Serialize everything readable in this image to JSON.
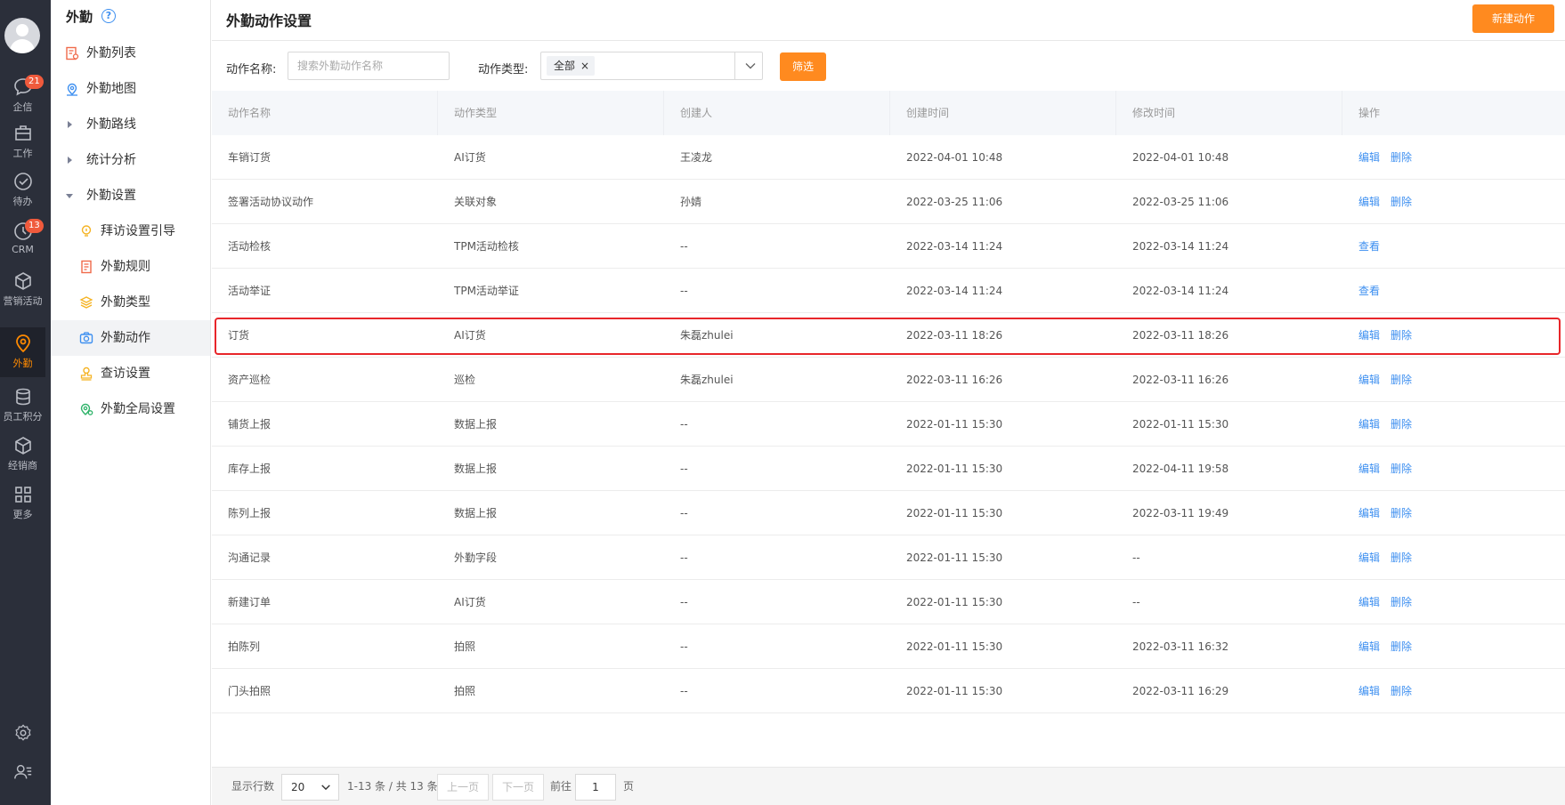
{
  "rail": {
    "items": [
      {
        "label": "企信",
        "badge": "21"
      },
      {
        "label": "工作"
      },
      {
        "label": "待办"
      },
      {
        "label": "CRM",
        "badge": "13"
      },
      {
        "label": "营销活动"
      },
      {
        "label": "外勤"
      },
      {
        "label": "员工积分"
      },
      {
        "label": "经销商"
      },
      {
        "label": "更多"
      }
    ]
  },
  "menu": {
    "title": "外勤",
    "items": [
      {
        "label": "外勤列表"
      },
      {
        "label": "外勤地图"
      },
      {
        "label": "外勤路线"
      },
      {
        "label": "统计分析"
      },
      {
        "label": "外勤设置"
      },
      {
        "label": "拜访设置引导"
      },
      {
        "label": "外勤规则"
      },
      {
        "label": "外勤类型"
      },
      {
        "label": "外勤动作"
      },
      {
        "label": "查访设置"
      },
      {
        "label": "外勤全局设置"
      }
    ]
  },
  "main": {
    "title": "外勤动作设置",
    "new_button": "新建动作",
    "filter": {
      "name_label": "动作名称:",
      "name_placeholder": "搜索外勤动作名称",
      "type_label": "动作类型:",
      "type_tag": "全部",
      "tag_close": "×",
      "filter_button": "筛选"
    }
  },
  "table": {
    "headers": [
      "动作名称",
      "动作类型",
      "创建人",
      "创建时间",
      "修改时间",
      "操作"
    ],
    "rows": [
      {
        "name": "车销订货",
        "type": "AI订货",
        "creator": "王凌龙",
        "created": "2022-04-01 10:48",
        "modified": "2022-04-01 10:48",
        "op1": "编辑",
        "op2": "删除"
      },
      {
        "name": "签署活动协议动作",
        "type": "关联对象",
        "creator": "孙婧",
        "created": "2022-03-25 11:06",
        "modified": "2022-03-25 11:06",
        "op1": "编辑",
        "op2": "删除"
      },
      {
        "name": "活动检核",
        "type": "TPM活动检核",
        "creator": "--",
        "created": "2022-03-14 11:24",
        "modified": "2022-03-14 11:24",
        "op1": "查看",
        "op2": ""
      },
      {
        "name": "活动举证",
        "type": "TPM活动举证",
        "creator": "--",
        "created": "2022-03-14 11:24",
        "modified": "2022-03-14 11:24",
        "op1": "查看",
        "op2": ""
      },
      {
        "name": "订货",
        "type": "AI订货",
        "creator": "朱磊zhulei",
        "created": "2022-03-11 18:26",
        "modified": "2022-03-11 18:26",
        "op1": "编辑",
        "op2": "删除"
      },
      {
        "name": "资产巡检",
        "type": "巡检",
        "creator": "朱磊zhulei",
        "created": "2022-03-11 16:26",
        "modified": "2022-03-11 16:26",
        "op1": "编辑",
        "op2": "删除"
      },
      {
        "name": "铺货上报",
        "type": "数据上报",
        "creator": "--",
        "created": "2022-01-11 15:30",
        "modified": "2022-01-11 15:30",
        "op1": "编辑",
        "op2": "删除"
      },
      {
        "name": "库存上报",
        "type": "数据上报",
        "creator": "--",
        "created": "2022-01-11 15:30",
        "modified": "2022-04-11 19:58",
        "op1": "编辑",
        "op2": "删除"
      },
      {
        "name": "陈列上报",
        "type": "数据上报",
        "creator": "--",
        "created": "2022-01-11 15:30",
        "modified": "2022-03-11 19:49",
        "op1": "编辑",
        "op2": "删除"
      },
      {
        "name": "沟通记录",
        "type": "外勤字段",
        "creator": "--",
        "created": "2022-01-11 15:30",
        "modified": "--",
        "op1": "编辑",
        "op2": "删除"
      },
      {
        "name": "新建订单",
        "type": "AI订货",
        "creator": "--",
        "created": "2022-01-11 15:30",
        "modified": "--",
        "op1": "编辑",
        "op2": "删除"
      },
      {
        "name": "拍陈列",
        "type": "拍照",
        "creator": "--",
        "created": "2022-01-11 15:30",
        "modified": "2022-03-11 16:32",
        "op1": "编辑",
        "op2": "删除"
      },
      {
        "name": "门头拍照",
        "type": "拍照",
        "creator": "--",
        "created": "2022-01-11 15:30",
        "modified": "2022-03-11 16:29",
        "op1": "编辑",
        "op2": "删除"
      }
    ]
  },
  "pagination": {
    "rows_label": "显示行数",
    "page_size": "20",
    "summary": "1-13 条 / 共 13 条",
    "prev": "上一页",
    "next": "下一页",
    "goto_label": "前往",
    "current_page": "1",
    "page_unit": "页"
  },
  "colors": {
    "accent": "#ff8a1f",
    "link": "#3d8ff0",
    "highlight": "#e8262a",
    "rail": "#2b2f3a"
  }
}
